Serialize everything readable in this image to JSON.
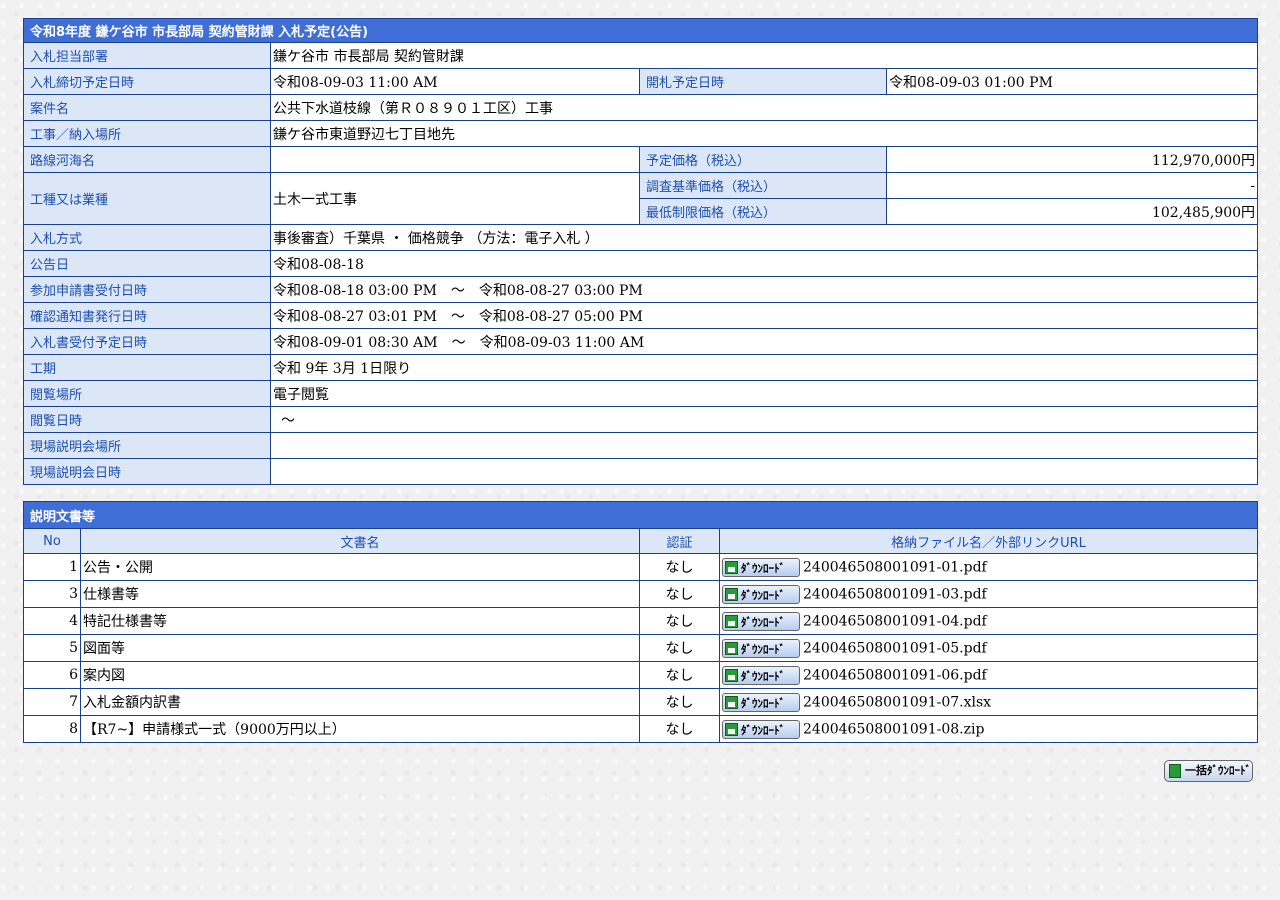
{
  "notice": {
    "title": "令和8年度 鎌ケ谷市 市長部局 契約管財課 入札予定(公告)",
    "rows": {
      "dept_label": "入札担当部署",
      "dept_value": "鎌ケ谷市 市長部局 契約管財課",
      "deadline_label": "入札締切予定日時",
      "deadline_value": "令和08-09-03 11:00 AM",
      "opening_label": "開札予定日時",
      "opening_value": "令和08-09-03 01:00 PM",
      "case_label": "案件名",
      "case_value": "公共下水道枝線（第Ｒ０８９０１工区）工事",
      "place_label": "工事／納入場所",
      "place_value": "鎌ケ谷市東道野辺七丁目地先",
      "route_label": "路線河海名",
      "route_value": "",
      "planned_price_label": "予定価格（税込）",
      "planned_price_value": "112,970,000円",
      "type_label": "工種又は業種",
      "type_value": "土木一式工事",
      "survey_price_label": "調査基準価格（税込）",
      "survey_price_value": "-",
      "min_price_label": "最低制限価格（税込）",
      "min_price_value": "102,485,900円",
      "method_label": "入札方式",
      "method_value": "事後審査）千葉県 ・ 価格競争 （方法：電子入札 ）",
      "announce_label": "公告日",
      "announce_value": "令和08-08-18",
      "apply_label": "参加申請書受付日時",
      "apply_value": "令和08-08-18 03:00 PM　～　令和08-08-27 03:00 PM",
      "confirm_label": "確認通知書発行日時",
      "confirm_value": "令和08-08-27 03:01 PM　～　令和08-08-27 05:00 PM",
      "receive_label": "入札書受付予定日時",
      "receive_value": "令和08-09-01 08:30 AM　～　令和08-09-03 11:00 AM",
      "period_label": "工期",
      "period_value": "令和 9年 3月 1日限り",
      "view_place_label": "閲覧場所",
      "view_place_value": "電子閲覧",
      "view_date_label": "閲覧日時",
      "view_date_value": "～",
      "site_place_label": "現場説明会場所",
      "site_place_value": "",
      "site_date_label": "現場説明会日時",
      "site_date_value": ""
    }
  },
  "documents": {
    "title": "説明文書等",
    "headers": {
      "no": "No",
      "name": "文書名",
      "cert": "認証",
      "file": "格納ファイル名／外部リンクURL"
    },
    "download_label": "ﾀﾞｳﾝﾛｰﾄﾞ",
    "rows": [
      {
        "no": "1",
        "name": "公告・公開",
        "cert": "なし",
        "file": "240046508001091-01.pdf"
      },
      {
        "no": "3",
        "name": "仕様書等",
        "cert": "なし",
        "file": "240046508001091-03.pdf"
      },
      {
        "no": "4",
        "name": "特記仕様書等",
        "cert": "なし",
        "file": "240046508001091-04.pdf"
      },
      {
        "no": "5",
        "name": "図面等",
        "cert": "なし",
        "file": "240046508001091-05.pdf"
      },
      {
        "no": "6",
        "name": "案内図",
        "cert": "なし",
        "file": "240046508001091-06.pdf"
      },
      {
        "no": "7",
        "name": "入札金額内訳書",
        "cert": "なし",
        "file": "240046508001091-07.xlsx"
      },
      {
        "no": "8",
        "name": "【R7~】申請様式一式（9000万円以上）",
        "cert": "なし",
        "file": "240046508001091-08.zip"
      }
    ],
    "bulk_label": "一括ﾀﾞｳﾝﾛｰﾄﾞ"
  }
}
